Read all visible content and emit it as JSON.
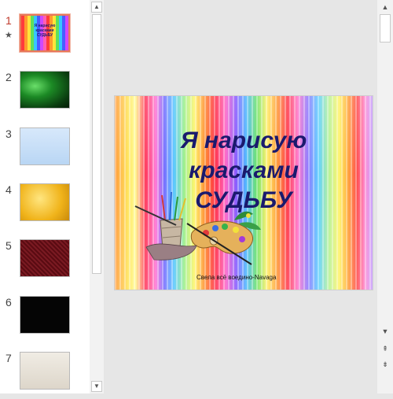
{
  "thumbnails": [
    {
      "number": "1",
      "starred": true,
      "active": true,
      "bg": "rainbow",
      "caption": "Я нарисую красками СУДЬБУ"
    },
    {
      "number": "2",
      "bg": "green",
      "caption": ""
    },
    {
      "number": "3",
      "bg": "snow",
      "caption": ""
    },
    {
      "number": "4",
      "bg": "gold",
      "caption": ""
    },
    {
      "number": "5",
      "bg": "maroon",
      "caption": ""
    },
    {
      "number": "6",
      "bg": "black",
      "caption": ""
    },
    {
      "number": "7",
      "bg": "paper",
      "caption": ""
    }
  ],
  "star_glyph": "★",
  "slide": {
    "title_lines": [
      "Я нарисую",
      "красками",
      "СУДЬБУ"
    ],
    "credit": "Свела всё воедино-Navaga",
    "title_color": "#1a1a6e"
  },
  "accent_color": "#e7785a",
  "icons": {
    "scroll_up": "▲",
    "scroll_down": "▼",
    "prev_slide": "⇞",
    "next_slide": "⇟"
  }
}
